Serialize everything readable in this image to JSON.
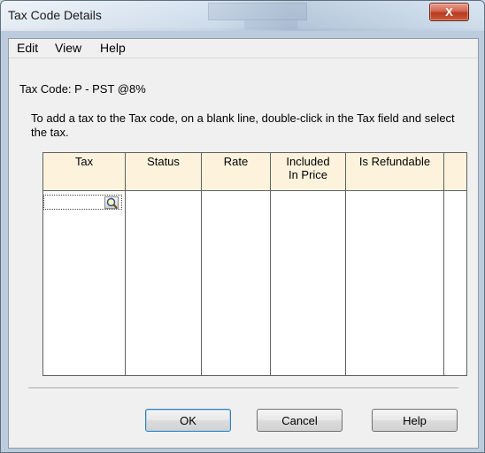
{
  "window": {
    "title": "Tax Code Details",
    "close_glyph": "X"
  },
  "menu": {
    "items": [
      "Edit",
      "View",
      "Help"
    ]
  },
  "tax_code": {
    "line": "Tax Code: P - PST @8%"
  },
  "instruction": "To add a tax to the Tax code, on a blank line, double-click in the Tax field and select the tax.",
  "grid": {
    "columns": [
      "Tax",
      "Status",
      "Rate",
      "Included\nIn Price",
      "Is Refundable"
    ],
    "rows": [
      {
        "tax": "",
        "status": "",
        "rate": "",
        "included_in_price": "",
        "is_refundable": ""
      }
    ],
    "header_color": "#fdf3dd"
  },
  "icons": {
    "lookup": "magnifier-icon",
    "close": "close-icon"
  },
  "buttons": {
    "ok": "OK",
    "cancel": "Cancel",
    "help": "Help"
  },
  "colors": {
    "close_button": "#c95a3c",
    "default_button_border": "#3c7fb1"
  }
}
